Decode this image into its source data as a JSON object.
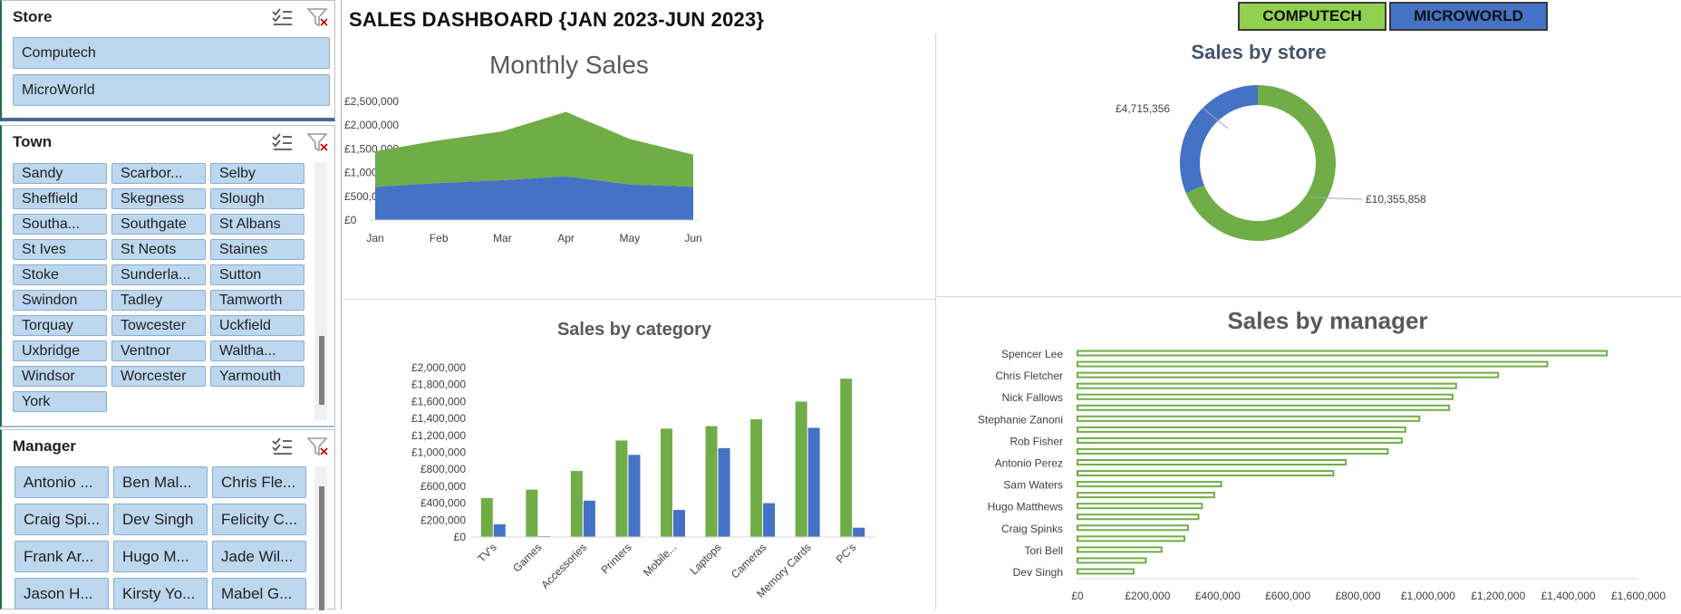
{
  "title": "SALES DASHBOARD {JAN 2023-JUN 2023}",
  "store_buttons": [
    {
      "label": "COMPUTECH",
      "color": "#92d050"
    },
    {
      "label": "MICROWORLD",
      "color": "#4472c4"
    }
  ],
  "slicers": {
    "store": {
      "header": "Store",
      "items": [
        "Computech",
        "MicroWorld"
      ]
    },
    "town": {
      "header": "Town",
      "items": [
        "Sandy",
        "Scarbor...",
        "Selby",
        "Sheffield",
        "Skegness",
        "Slough",
        "Southa...",
        "Southgate",
        "St Albans",
        "St Ives",
        "St Neots",
        "Staines",
        "Stoke",
        "Sunderla...",
        "Sutton",
        "Swindon",
        "Tadley",
        "Tamworth",
        "Torquay",
        "Towcester",
        "Uckfield",
        "Uxbridge",
        "Ventnor",
        "Waltha...",
        "Windsor",
        "Worcester",
        "Yarmouth",
        "York"
      ]
    },
    "manager": {
      "header": "Manager",
      "items": [
        "Antonio ...",
        "Ben Mal...",
        "Chris Fle...",
        "Craig Spi...",
        "Dev Singh",
        "Felicity C...",
        "Frank Ar...",
        "Hugo M...",
        "Jade Wil...",
        "Jason H...",
        "Kirsty Yo...",
        "Mabel G..."
      ]
    }
  },
  "icons": {
    "multi_select": "multi-select-icon",
    "clear_filter": "clear-filter-icon"
  },
  "colors": {
    "computech": "#70ad47",
    "microworld": "#4472c4",
    "slicer_item": "#bdd7ee"
  },
  "chart_data": [
    {
      "type": "area",
      "title": "Monthly Sales",
      "categories": [
        "Jan",
        "Feb",
        "Mar",
        "Apr",
        "May",
        "Jun"
      ],
      "y_ticks": [
        "£0",
        "£500,000",
        "£1,000,000",
        "£1,500,000",
        "£2,000,000",
        "£2,500,000"
      ],
      "ylim": [
        0,
        2500000
      ],
      "stacked": true,
      "series": [
        {
          "values": [
            700000,
            780000,
            840000,
            920000,
            750000,
            700000
          ],
          "color": "#4472c4"
        },
        {
          "values": [
            750000,
            900000,
            1030000,
            1360000,
            960000,
            680000
          ],
          "color": "#70ad47"
        }
      ]
    },
    {
      "type": "pie",
      "title": "Sales by store",
      "slices": [
        {
          "value": 10355858,
          "label": "£10,355,858",
          "color": "#70ad47"
        },
        {
          "value": 4715356,
          "label": "£4,715,356",
          "color": "#4472c4"
        }
      ]
    },
    {
      "type": "bar",
      "title": "Sales by category",
      "categories": [
        "TV's",
        "Games",
        "Accessories",
        "Printers",
        "Mobile...",
        "Laptops",
        "Cameras",
        "Memory Cards",
        "PC's"
      ],
      "y_ticks": [
        "£0",
        "£200,000",
        "£400,000",
        "£600,000",
        "£800,000",
        "£1,000,000",
        "£1,200,000",
        "£1,400,000",
        "£1,600,000",
        "£1,800,000",
        "£2,000,000"
      ],
      "ylim": [
        0,
        2000000
      ],
      "series": [
        {
          "values": [
            460000,
            560000,
            780000,
            1140000,
            1280000,
            1310000,
            1390000,
            1600000,
            1870000
          ],
          "color": "#70ad47"
        },
        {
          "values": [
            150000,
            10000,
            430000,
            970000,
            320000,
            1050000,
            400000,
            1290000,
            110000
          ],
          "color": "#4472c4"
        }
      ]
    },
    {
      "type": "bar",
      "orientation": "horizontal",
      "title": "Sales by manager",
      "category_labels": [
        "Spencer Lee",
        "Chris Fletcher",
        "Nick Fallows",
        "Stephanie Zanoni",
        "Rob Fisher",
        "Antonio Perez",
        "Sam Waters",
        "Hugo Matthews",
        "Craig Spinks",
        "Tori Bell",
        "Dev Singh"
      ],
      "x_ticks": [
        "£0",
        "£200,000",
        "£400,000",
        "£600,000",
        "£800,000",
        "£1,000,000",
        "£1,200,000",
        "£1,400,000",
        "£1,600,000"
      ],
      "xlim": [
        0,
        1600000
      ],
      "values": [
        1510000,
        1340000,
        1200000,
        1080000,
        1070000,
        1060000,
        975000,
        935000,
        925000,
        885000,
        765000,
        730000,
        410000,
        390000,
        355000,
        345000,
        315000,
        305000,
        240000,
        195000,
        160000
      ],
      "color": "#70ad47"
    }
  ]
}
